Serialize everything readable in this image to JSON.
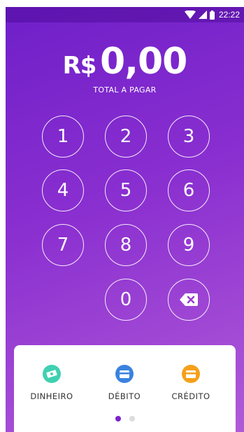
{
  "status_bar": {
    "time": "22:22",
    "icons": [
      "wifi-icon",
      "signal-icon",
      "battery-icon"
    ]
  },
  "amount": {
    "currency": "R$",
    "value": "0,00",
    "label": "TOTAL A PAGAR"
  },
  "keypad": {
    "keys": [
      "1",
      "2",
      "3",
      "4",
      "5",
      "6",
      "7",
      "8",
      "9",
      "0"
    ],
    "backspace_icon": "backspace-icon"
  },
  "payment_methods": [
    {
      "label": "DINHEIRO",
      "icon": "cash-icon",
      "color": "#3fd1b1"
    },
    {
      "label": "DÉBITO",
      "icon": "debit-card-icon",
      "color": "#3a82e0"
    },
    {
      "label": "CRÉDITO",
      "icon": "credit-card-icon",
      "color": "#f6a01a"
    }
  ],
  "pagination": {
    "pages": 2,
    "active": 1,
    "active_color": "#7b22cf",
    "inactive_color": "#dcdcdc"
  },
  "colors": {
    "gradient_start": "#6f1fc9",
    "gradient_end": "#b05ad8",
    "accent": "#7b22cf"
  }
}
